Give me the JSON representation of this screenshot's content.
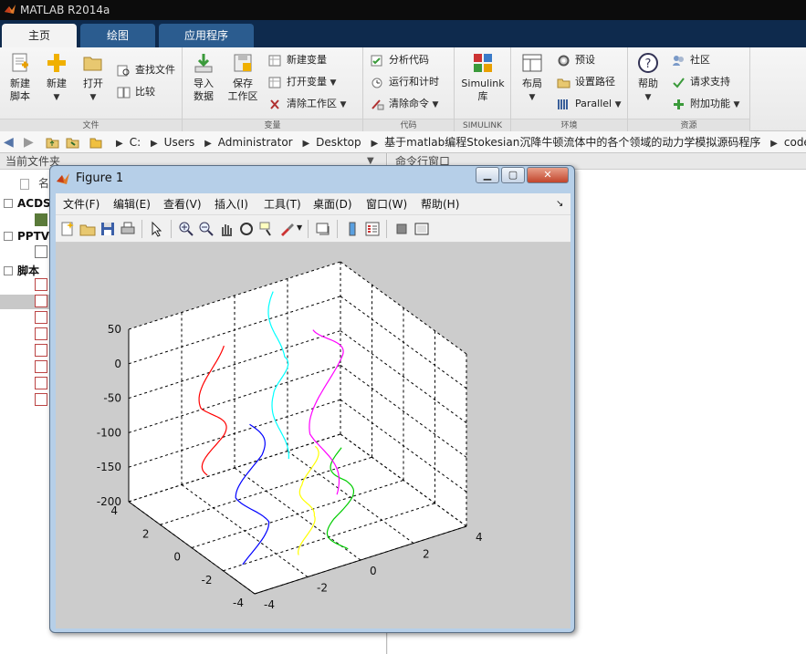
{
  "app": {
    "title": "MATLAB R2014a"
  },
  "tabs": [
    {
      "label": "主页",
      "active": true
    },
    {
      "label": "绘图",
      "active": false
    },
    {
      "label": "应用程序",
      "active": false
    }
  ],
  "ribbon": {
    "file_group": {
      "label": "文件",
      "new_script": "新建\n脚本",
      "new": "新建",
      "open": "打开",
      "find_files": "查找文件",
      "compare": "比较"
    },
    "variable_group": {
      "label": "变量",
      "import_data": "导入\n数据",
      "save_workspace": "保存\n工作区",
      "new_variable": "新建变量",
      "open_variable": "打开变量",
      "clear_workspace": "清除工作区"
    },
    "code_group": {
      "label": "代码",
      "analyze_code": "分析代码",
      "run_and_time": "运行和计时",
      "clear_commands": "清除命令"
    },
    "simulink_group": {
      "label": "SIMULINK",
      "simulink_library": "Simulink\n库"
    },
    "environment_group": {
      "label": "环境",
      "layout": "布局",
      "preferences": "预设",
      "set_path": "设置路径",
      "parallel": "Parallel"
    },
    "resources_group": {
      "label": "资源",
      "help": "帮助",
      "community": "社区",
      "request_support": "请求支持",
      "add_ons": "附加功能"
    }
  },
  "address": {
    "crumbs": [
      "C:",
      "Users",
      "Administrator",
      "Desktop",
      "基于matlab编程Stokesian沉降牛顿流体中的各个领域的动力学模拟源码程序",
      "code"
    ]
  },
  "current_folder": {
    "header": "当前文件夹",
    "column_name_partial": "名",
    "sections": [
      "ACDS",
      "PPTV",
      "脚本"
    ]
  },
  "command_window": {
    "header": "命令行窗口"
  },
  "figure": {
    "title": "Figure 1",
    "menu": [
      "文件(F)",
      "编辑(E)",
      "查看(V)",
      "插入(I)",
      "工具(T)",
      "桌面(D)",
      "窗口(W)",
      "帮助(H)"
    ],
    "z_ticks": [
      "50",
      "0",
      "-50",
      "-100",
      "-150",
      "-200"
    ],
    "x_ticks": [
      "4",
      "2",
      "0",
      "-2",
      "-4"
    ],
    "y_ticks": [
      "-4",
      "-2",
      "0",
      "2",
      "4"
    ]
  },
  "chart_data": {
    "type": "line",
    "title": "",
    "xlabel": "",
    "ylabel": "",
    "zlabel": "",
    "xlim": [
      -4,
      4
    ],
    "ylim": [
      -4,
      4
    ],
    "zlim": [
      -200,
      50
    ],
    "grid": true,
    "series": [
      {
        "color": "#0000ff",
        "x": [
          -2,
          -2,
          -2,
          -2,
          -2
        ],
        "y": [
          -3,
          -2.8,
          -3.1,
          -2.7,
          -3
        ],
        "z": [
          0,
          -50,
          -100,
          -150,
          -200
        ]
      },
      {
        "color": "#ffff00",
        "x": [
          -2.5,
          -2.5,
          -2.5,
          -2.5
        ],
        "y": [
          -1.2,
          -0.9,
          -1.3,
          -1.0
        ],
        "z": [
          -50,
          -100,
          -150,
          -200
        ]
      },
      {
        "color": "#ff0000",
        "x": [
          2,
          2,
          2,
          2
        ],
        "y": [
          -2,
          -2.1,
          -1.9,
          -2.0
        ],
        "z": [
          30,
          -50,
          -100,
          -150
        ]
      },
      {
        "color": "#00cc00",
        "x": [
          -1,
          -1,
          -1,
          -1
        ],
        "y": [
          1,
          1.2,
          0.9,
          1.1
        ],
        "z": [
          -100,
          -150,
          -200,
          -250
        ]
      },
      {
        "color": "#00ffff",
        "x": [
          3.5,
          3.5,
          3.5,
          3.5
        ],
        "y": [
          1.5,
          1.2,
          1.6,
          1.3
        ],
        "z": [
          50,
          -50,
          -100,
          -200
        ]
      },
      {
        "color": "#ff00ff",
        "x": [
          2.5,
          2.5,
          2.5,
          2.5
        ],
        "y": [
          2.5,
          2.8,
          2.3,
          2.7
        ],
        "z": [
          0,
          -50,
          -150,
          -250
        ]
      }
    ]
  },
  "colors": {
    "titlebar": "#0c0c0c",
    "tabbar": "#0e2a4d",
    "figure_bg": "#cccccc"
  }
}
